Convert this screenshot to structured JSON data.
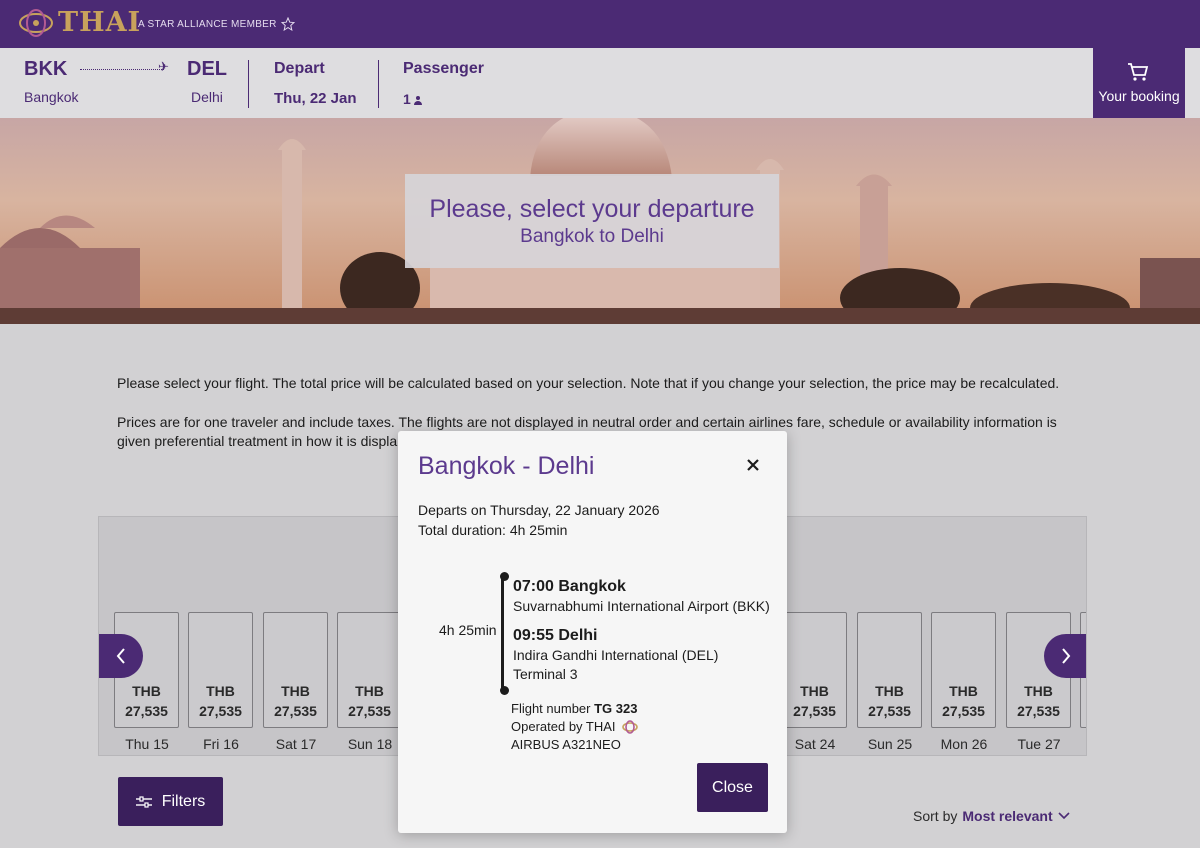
{
  "brand": {
    "name": "THAI",
    "alliance": "A STAR ALLIANCE MEMBER",
    "color": "#4b2a74",
    "gold": "#c8a25c"
  },
  "summary": {
    "origin_code": "BKK",
    "origin_city": "Bangkok",
    "dest_code": "DEL",
    "dest_city": "Delhi",
    "depart_label": "Depart",
    "depart_value": "Thu, 22 Jan",
    "passenger_label": "Passenger",
    "passenger_count": "1",
    "booking_label": "Your booking"
  },
  "hero": {
    "title": "Please, select your departure",
    "subtitle": "Bangkok to Delhi"
  },
  "info": {
    "line1": "Please select your flight. The total price will be calculated based on your selection. Note that if you change your selection, the price may be recalculated.",
    "line2": "Prices are for one traveler and include taxes. The flights are not displayed in neutral order and certain airlines fare, schedule or availability information is given preferential treatment in how it is displa"
  },
  "calendar": {
    "days": [
      {
        "currency": "THB",
        "price": "27,535",
        "label": "Thu 15"
      },
      {
        "currency": "THB",
        "price": "27,535",
        "label": "Fri 16"
      },
      {
        "currency": "THB",
        "price": "27,535",
        "label": "Sat 17"
      },
      {
        "currency": "THB",
        "price": "27,535",
        "label": "Sun 18"
      },
      {
        "currency": "THB",
        "price": "27,535",
        "label": "Sat 24"
      },
      {
        "currency": "THB",
        "price": "27,535",
        "label": "Sun 25"
      },
      {
        "currency": "THB",
        "price": "27,535",
        "label": "Mon 26"
      },
      {
        "currency": "THB",
        "price": "27,535",
        "label": "Tue 27"
      }
    ]
  },
  "controls": {
    "filters_label": "Filters",
    "sort_label": "Sort by",
    "sort_value": "Most relevant"
  },
  "modal": {
    "title": "Bangkok - Delhi",
    "departs": "Departs on Thursday, 22 January 2026",
    "duration_total": "Total duration: 4h 25min",
    "duration": "4h 25min",
    "dep_time_city": "07:00 Bangkok",
    "dep_airport": "Suvarnabhumi International Airport (BKK)",
    "arr_time_city": "09:55 Delhi",
    "arr_airport": "Indira Gandhi International (DEL)",
    "arr_terminal": "Terminal 3",
    "flight_number_label": "Flight number",
    "flight_number": "TG 323",
    "operated_by": "Operated by THAI",
    "aircraft": "AIRBUS A321NEO",
    "close_label": "Close"
  }
}
